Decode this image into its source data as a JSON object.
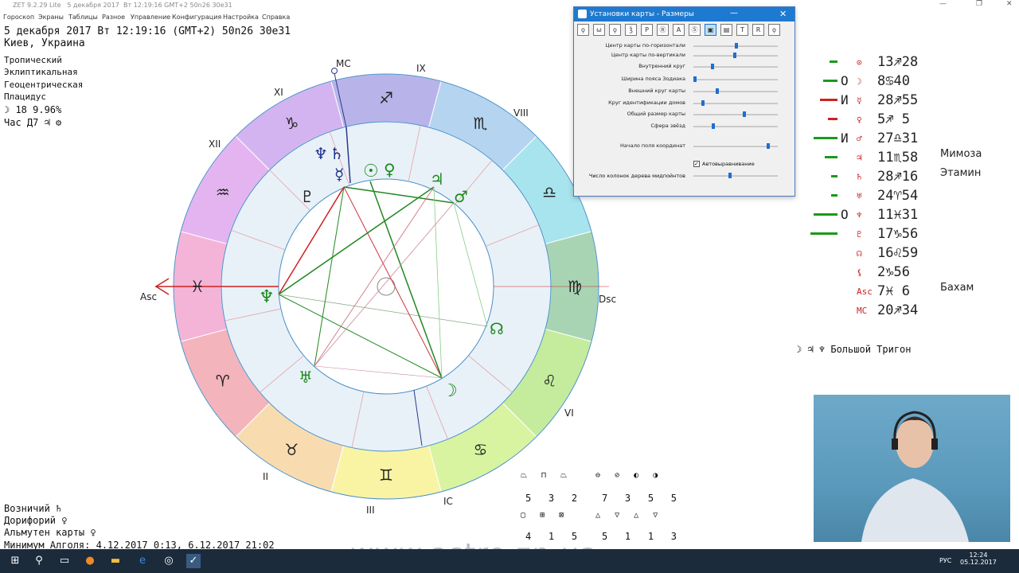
{
  "window": {
    "app_title": "ZET 9.2.29 Lite",
    "title_date": "5 декабря 2017",
    "title_time": "Вт   12:19:16 GMT+2 50n26  30e31"
  },
  "menu": [
    "Гороскоп",
    "Экраны",
    "Таблицы",
    "Разное",
    "Управление",
    "Конфигурация",
    "Настройка",
    "Справка"
  ],
  "header": {
    "line1": "5 декабря 2017  Вт  12:19:16 (GMT+2) 50n26  30e31",
    "line2": "Киев, Украина"
  },
  "settings_info": [
    "Тропический",
    "Эклиптикальная",
    "Геоцентрическая",
    "Плацидус"
  ],
  "moon_phase": "☽ 18 9.96%",
  "hour_ruler": "Час Д7 ♃ ⚙",
  "chart": {
    "axis_labels": {
      "mc": "MC",
      "asc": "Asc",
      "dsc": "Dsc",
      "ic": "IC"
    },
    "houses": [
      "IX",
      "VIII",
      "VI",
      "XI",
      "XII",
      "II",
      "III"
    ],
    "zodiac": [
      "♐",
      "♏",
      "♎",
      "♍",
      "♌",
      "♋",
      "♊",
      "♉",
      "♈",
      "♓",
      "♒",
      "♑"
    ],
    "planets": {
      "mercury": "☿",
      "saturn": "♄",
      "neptune_top": "♆",
      "sun": "☉",
      "venus": "♀",
      "jupiter": "♃",
      "mars": "♂",
      "pluto": "♇",
      "neptune": "♆",
      "uranus": "♅",
      "moon": "☽",
      "node": "☊"
    }
  },
  "dialog": {
    "title": "Установки карты - Размеры",
    "toolbar": [
      "ǫ",
      "ѡ",
      "ǫ",
      "ǯ",
      "P",
      "Ⓡ",
      "A",
      "Ⓢ",
      "▣",
      "▤",
      "T",
      "R",
      "ǫ"
    ],
    "sliders": [
      {
        "label": "Центр карты по-горизонтали",
        "value": 0.52
      },
      {
        "label": "Центр карты по-вертикали",
        "value": 0.5
      },
      {
        "label": "Внутренний круг",
        "value": 0.22
      },
      {
        "label": "Ширина пояса Зодиака",
        "value": 0.0
      },
      {
        "label": "Внешний круг карты",
        "value": 0.28
      },
      {
        "label": "Круг идентификации домов",
        "value": 0.1
      },
      {
        "label": "Общий размер карты",
        "value": 0.62
      },
      {
        "label": "Сфера звёзд",
        "value": 0.23
      },
      {
        "label": "Начало поля координат",
        "value": 0.92
      }
    ],
    "checkbox_label": "Автовыравнивание",
    "midpoint_label": "Число колонок дерева мидпойнтов"
  },
  "planet_list": [
    {
      "mark": "▬",
      "aspect": "",
      "sym": "⊙",
      "deg": "13",
      "sign": "♐",
      "min": "28",
      "star": ""
    },
    {
      "mark": "▬",
      "aspect": "O",
      "sym": "☽",
      "deg": "8",
      "sign": "♋",
      "min": "40",
      "star": ""
    },
    {
      "mark": "▬",
      "aspect": "И",
      "sym": "☿",
      "deg": "28",
      "sign": "♐",
      "min": "55",
      "star": ""
    },
    {
      "mark": "▬",
      "aspect": "",
      "sym": "♀",
      "deg": "5",
      "sign": "♐",
      "min": "5",
      "star": ""
    },
    {
      "mark": "▬",
      "aspect": "И",
      "sym": "♂",
      "deg": "27",
      "sign": "♎",
      "min": "31",
      "star": ""
    },
    {
      "mark": "▬",
      "aspect": "",
      "sym": "♃",
      "deg": "11",
      "sign": "♏",
      "min": "58",
      "star": "Мимоза"
    },
    {
      "mark": "▬",
      "aspect": "",
      "sym": "♄",
      "deg": "28",
      "sign": "♐",
      "min": "16",
      "star": "Этамин"
    },
    {
      "mark": "▬",
      "aspect": "",
      "sym": "♅",
      "deg": "24",
      "sign": "♈",
      "min": "54",
      "star": ""
    },
    {
      "mark": "▬",
      "aspect": "O",
      "sym": "♆",
      "deg": "11",
      "sign": "♓",
      "min": "31",
      "star": ""
    },
    {
      "mark": "▬",
      "aspect": "",
      "sym": "♇",
      "deg": "17",
      "sign": "♑",
      "min": "56",
      "star": ""
    },
    {
      "mark": "",
      "aspect": "",
      "sym": "☊",
      "deg": "16",
      "sign": "♌",
      "min": "59",
      "star": ""
    },
    {
      "mark": "",
      "aspect": "",
      "sym": "⚸",
      "deg": "2",
      "sign": "♑",
      "min": "56",
      "star": ""
    },
    {
      "mark": "",
      "aspect": "",
      "sym": "Asc",
      "deg": "7",
      "sign": "♓",
      "min": "6",
      "star": "Бахам"
    },
    {
      "mark": "",
      "aspect": "",
      "sym": "MC",
      "deg": "20",
      "sign": "♐",
      "min": "34",
      "star": ""
    }
  ],
  "grand_trine": "☽ ♃ ♆  Большой Тригон",
  "footer_info": [
    "Возничий ♄",
    "Дорифорий ♀",
    "Альмутен карты ♀",
    "Минимум Алголя: 4.12.2017  0:13,  6.12.2017 21:02"
  ],
  "elements_table": {
    "row_counts1": [
      "5",
      "3",
      "2"
    ],
    "row_counts2": [
      "7",
      "3",
      "5",
      "5"
    ],
    "row_counts3": [
      "4",
      "1",
      "5"
    ],
    "row_counts4": [
      "5",
      "1",
      "1",
      "3"
    ]
  },
  "watermark": "www.astro.zp.ua",
  "taskbar": {
    "lang": "РУС",
    "time": "12:24",
    "date": "05.12.2017"
  }
}
